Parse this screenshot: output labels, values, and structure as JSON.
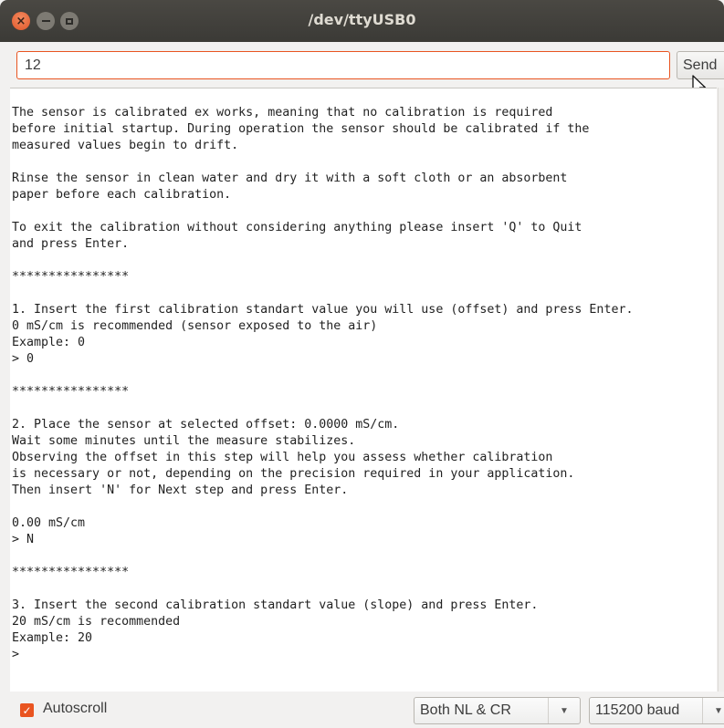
{
  "window": {
    "title": "/dev/ttyUSB0",
    "close_glyph": "×"
  },
  "send": {
    "input_value": "12",
    "button_label": "Send"
  },
  "console": {
    "lines": [
      "The sensor is calibrated ex works, meaning that no calibration is required",
      "before initial startup. During operation the sensor should be calibrated if the",
      "measured values begin to drift.",
      "",
      "Rinse the sensor in clean water and dry it with a soft cloth or an absorbent",
      "paper before each calibration.",
      "",
      "To exit the calibration without considering anything please insert 'Q' to Quit",
      "and press Enter.",
      "",
      "****************",
      "",
      "1. Insert the first calibration standart value you will use (offset) and press Enter.",
      "0 mS/cm is recommended (sensor exposed to the air)",
      "Example: 0",
      "> 0",
      "",
      "****************",
      "",
      "2. Place the sensor at selected offset: 0.0000 mS/cm.",
      "Wait some minutes until the measure stabilizes.",
      "Observing the offset in this step will help you assess whether calibration",
      "is necessary or not, depending on the precision required in your application.",
      "Then insert 'N' for Next step and press Enter.",
      "",
      "0.00 mS/cm",
      "> N",
      "",
      "****************",
      "",
      "3. Insert the second calibration standart value (slope) and press Enter.",
      "20 mS/cm is recommended",
      "Example: 20",
      ">"
    ]
  },
  "bottom": {
    "autoscroll_label": "Autoscroll",
    "autoscroll_checked": true,
    "line_ending": "Both NL & CR",
    "baud_rate": "115200 baud"
  },
  "colors": {
    "accent": "#e95420",
    "titlebar": "#3b3a36",
    "panel": "#f2f1f0"
  },
  "icons": {
    "close": "close-icon",
    "minimize": "minimize-icon",
    "maximize": "maximize-icon",
    "checkbox": "checkmark-icon",
    "dropdown": "chevron-down-icon",
    "pointer": "mouse-pointer-icon"
  }
}
